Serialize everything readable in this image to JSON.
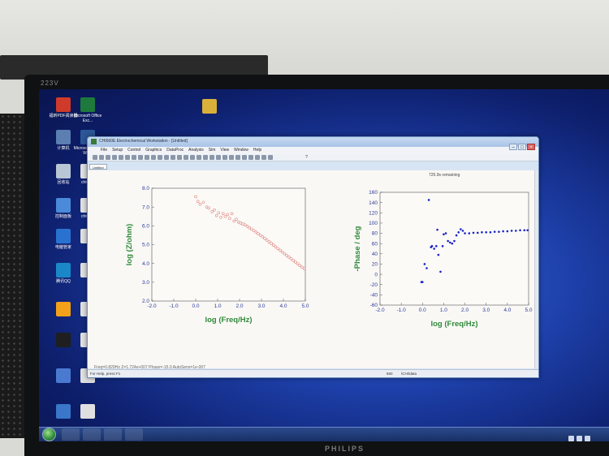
{
  "monitor": {
    "model": "223V",
    "brand": "PHILIPS"
  },
  "desktop_icons": [
    {
      "label": "福昕PDF阅读器",
      "color": "#d03a2a"
    },
    {
      "label": "Microsoft Office Exc...",
      "color": "#1d7a3c"
    },
    {
      "label": "",
      "color": "#d9b13a"
    },
    {
      "label": "计算机",
      "color": "#5a7fb0"
    },
    {
      "label": "Microsoft Office Wo...",
      "color": "#2b5797"
    },
    {
      "label": "回收站",
      "color": "#b8c6d6"
    },
    {
      "label": "chi66...",
      "color": "#e0e0e0"
    },
    {
      "label": "控制面板",
      "color": "#4a8ad8"
    },
    {
      "label": "chi66...",
      "color": "#e0e0e0"
    },
    {
      "label": "电脑管家",
      "color": "#2a72d0"
    },
    {
      "label": "",
      "color": "#e0e0e0"
    },
    {
      "label": "腾讯QQ",
      "color": "#1a88c8"
    },
    {
      "label": "",
      "color": "#e0e0e0"
    },
    {
      "label": "",
      "color": "#f2a11a"
    },
    {
      "label": "",
      "color": "#e0e0e0"
    },
    {
      "label": "",
      "color": "#1f1f1f"
    },
    {
      "label": "",
      "color": "#e0e0e0"
    },
    {
      "label": "",
      "color": "#4a7ad0"
    },
    {
      "label": "",
      "color": "#e0e0e0"
    },
    {
      "label": "",
      "color": "#3a76c9"
    },
    {
      "label": "",
      "color": "#e0e0e0"
    }
  ],
  "window": {
    "title": "CHI660E Electrochemical Workstation - [Untitled]",
    "menus": [
      "File",
      "Setup",
      "Control",
      "Graphics",
      "DataProc",
      "Analysis",
      "Sim",
      "View",
      "Window",
      "Help"
    ],
    "toolbar_label": "?",
    "doc_tab": "Untitled",
    "time_remaining": "725.9s remaining",
    "readout": "Freq=0.829Hz  Z=1.724e+007  Phase=-15.0  AutoSens=1e-007",
    "status_left": "For Help, press F1",
    "status_mid": "660",
    "status_right": "\\CHI\\data"
  },
  "chart_data": [
    {
      "type": "scatter",
      "title": "",
      "xlabel": "log (Freq/Hz)",
      "ylabel": "log (Z/ohm)",
      "xlim": [
        -2.0,
        5.0
      ],
      "ylim": [
        2.0,
        8.0
      ],
      "xticks": [
        "-2.0",
        "-1.0",
        "0.0",
        "1.0",
        "2.0",
        "3.0",
        "4.0",
        "5.0"
      ],
      "yticks": [
        "2.0",
        "3.0",
        "4.0",
        "5.0",
        "6.0",
        "7.0",
        "8.0"
      ],
      "marker": "open-circle",
      "color": "#e08a84",
      "x": [
        0.0,
        0.1,
        0.2,
        0.35,
        0.5,
        0.6,
        0.75,
        0.85,
        0.95,
        1.05,
        1.15,
        1.25,
        1.35,
        1.45,
        1.55,
        1.65,
        1.75,
        1.85,
        1.95,
        2.05,
        2.15,
        2.25,
        2.35,
        2.45,
        2.55,
        2.65,
        2.75,
        2.85,
        2.95,
        3.05,
        3.15,
        3.25,
        3.35,
        3.45,
        3.55,
        3.65,
        3.75,
        3.85,
        3.95,
        4.05,
        4.15,
        4.25,
        4.35,
        4.45,
        4.55,
        4.65,
        4.75,
        4.85,
        4.95
      ],
      "y": [
        7.55,
        7.3,
        7.15,
        7.25,
        7.0,
        6.95,
        6.75,
        6.85,
        6.55,
        6.7,
        6.45,
        6.65,
        6.5,
        6.6,
        6.4,
        6.65,
        6.25,
        6.35,
        6.2,
        6.15,
        6.1,
        6.05,
        5.98,
        5.9,
        5.82,
        5.75,
        5.67,
        5.58,
        5.5,
        5.42,
        5.33,
        5.24,
        5.15,
        5.06,
        4.97,
        4.88,
        4.79,
        4.7,
        4.61,
        4.52,
        4.43,
        4.34,
        4.25,
        4.16,
        4.07,
        3.98,
        3.89,
        3.8,
        3.72
      ]
    },
    {
      "type": "scatter",
      "title": "",
      "xlabel": "log (Freq/Hz)",
      "ylabel": "-Phase / deg",
      "xlim": [
        -2.0,
        5.0
      ],
      "ylim": [
        -60,
        160
      ],
      "xticks": [
        "-2.0",
        "-1.0",
        "0.0",
        "1.0",
        "2.0",
        "3.0",
        "4.0",
        "5.0"
      ],
      "yticks": [
        "-60",
        "-40",
        "-20",
        "0",
        "20",
        "40",
        "60",
        "80",
        "100",
        "120",
        "140",
        "160"
      ],
      "marker": "filled-dot",
      "color": "#1a22c8",
      "x": [
        -0.05,
        0.0,
        0.1,
        0.2,
        0.3,
        0.4,
        0.45,
        0.55,
        0.65,
        0.7,
        0.75,
        0.85,
        0.95,
        1.0,
        1.1,
        1.2,
        1.3,
        1.4,
        1.5,
        1.6,
        1.7,
        1.8,
        1.9,
        2.0,
        2.2,
        2.4,
        2.6,
        2.8,
        3.0,
        3.2,
        3.4,
        3.6,
        3.8,
        4.0,
        4.2,
        4.4,
        4.6,
        4.8,
        4.95
      ],
      "y": [
        -15,
        -15,
        20,
        12,
        145,
        53,
        55,
        50,
        55,
        87,
        38,
        5,
        55,
        78,
        80,
        65,
        62,
        60,
        65,
        76,
        82,
        88,
        85,
        80,
        80,
        81,
        81,
        82,
        82,
        82,
        83,
        83,
        84,
        84,
        85,
        85,
        86,
        86,
        86
      ]
    }
  ]
}
